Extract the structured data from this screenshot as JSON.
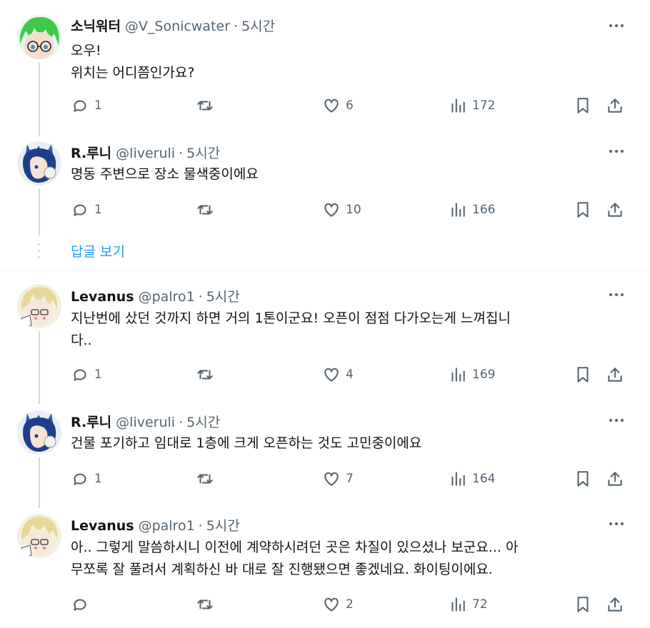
{
  "tweets": [
    {
      "name": "소닉워터",
      "handle": "@V_Sonicwater",
      "time": "5시간",
      "text": "오우!\n위치는 어디쯤인가요?",
      "replies": "1",
      "retweets": "",
      "likes": "6",
      "views": "172"
    },
    {
      "name": "R.루니",
      "handle": "@liveruli",
      "time": "5시간",
      "text": "명동 주변으로 장소 물색중이에요",
      "replies": "1",
      "retweets": "",
      "likes": "10",
      "views": "166"
    },
    {
      "name": "Levanus",
      "handle": "@palro1",
      "time": "5시간",
      "text": "지난번에 샀던 것까지 하면 거의 1톤이군요! 오픈이 점점 다가오는게 느껴집니\n다..",
      "replies": "1",
      "retweets": "",
      "likes": "4",
      "views": "169"
    },
    {
      "name": "R.루니",
      "handle": "@liveruli",
      "time": "5시간",
      "text": "건물 포기하고 임대로 1층에 크게 오픈하는 것도 고민중이에요",
      "replies": "1",
      "retweets": "",
      "likes": "7",
      "views": "164"
    },
    {
      "name": "Levanus",
      "handle": "@palro1",
      "time": "5시간",
      "text": "아.. 그렇게 말씀하시니 이전에 계약하시려던 곳은 차질이 있으셨나 보군요... 아\n무쪼록 잘 풀려서 계획하신 바 대로 잘 진행됐으면 좋겠네요. 화이팅이에요.",
      "replies": "",
      "retweets": "",
      "likes": "2",
      "views": "72"
    }
  ],
  "show_replies_label": "답글 보기",
  "icons": {
    "reply": "reply-icon",
    "retweet": "retweet-icon",
    "like": "heart-icon",
    "views": "views-icon",
    "bookmark": "bookmark-icon",
    "share": "share-icon",
    "more": "more-icon"
  },
  "colors": {
    "link": "#1d9bf0",
    "secondary": "#536471",
    "thread_line": "#cfd9de"
  }
}
